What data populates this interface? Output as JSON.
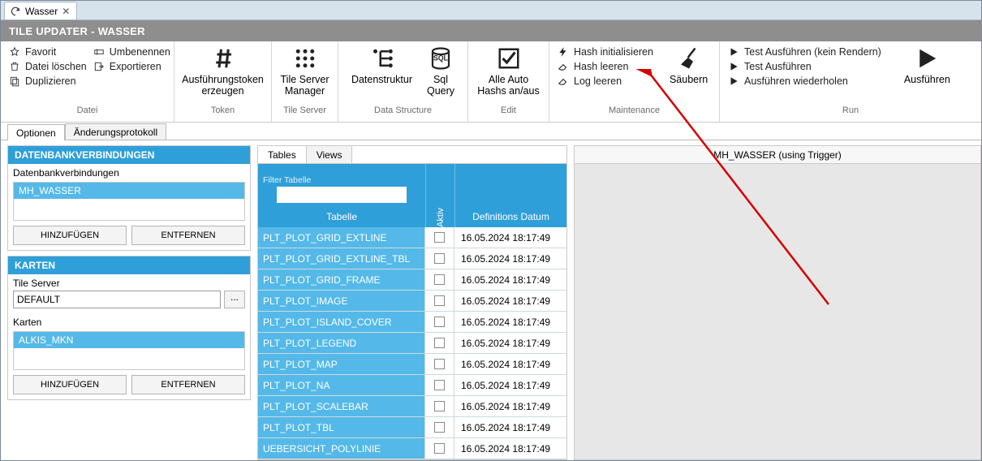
{
  "doc_tab": {
    "label": "Wasser"
  },
  "title": "TILE UPDATER - WASSER",
  "ribbon": {
    "datei": {
      "caption": "Datei",
      "favorit": "Favorit",
      "loeschen": "Datei löschen",
      "duplizieren": "Duplizieren",
      "umbenennen": "Umbenennen",
      "exportieren": "Exportieren"
    },
    "token": {
      "caption": "Token",
      "big": "Ausführungstoken\nerzeugen"
    },
    "tileserver": {
      "caption": "Tile Server",
      "big": "Tile Server\nManager"
    },
    "datastructure": {
      "caption": "Data Structure",
      "ds": "Datenstruktur",
      "sql": "Sql\nQuery"
    },
    "edit": {
      "caption": "Edit",
      "big": "Alle Auto\nHashs an/aus"
    },
    "maintenance": {
      "caption": "Maintenance",
      "hash_init": "Hash initialisieren",
      "hash_leeren": "Hash leeren",
      "log_leeren": "Log leeren",
      "saeubern": "Säubern"
    },
    "run": {
      "caption": "Run",
      "test_kein": "Test Ausführen (kein Rendern)",
      "test": "Test Ausführen",
      "wiederholen": "Ausführen wiederholen",
      "ausfuehren": "Ausführen"
    }
  },
  "subtabs": {
    "optionen": "Optionen",
    "protokoll": "Änderungsprotokoll"
  },
  "left": {
    "dbhead": "DATENBANKVERBINDUNGEN",
    "dblabel": "Datenbankverbindungen",
    "dbitem": "MH_WASSER",
    "add": "HINZUFÜGEN",
    "remove": "ENTFERNEN",
    "kartenhead": "KARTEN",
    "tslabel": "Tile Server",
    "tsvalue": "DEFAULT",
    "kartenlabel": "Karten",
    "kartenitem": "ALKIS_MKN"
  },
  "mid": {
    "tab_tables": "Tables",
    "tab_views": "Views",
    "filter_label": "Filter Tabelle",
    "col_tabelle": "Tabelle",
    "col_aktiv": "Aktiv",
    "col_def": "Definitions Datum",
    "rows": [
      {
        "t": "PLT_PLOT_GRID_EXTLINE",
        "d": "16.05.2024 18:17:49"
      },
      {
        "t": "PLT_PLOT_GRID_EXTLINE_TBL",
        "d": "16.05.2024 18:17:49"
      },
      {
        "t": "PLT_PLOT_GRID_FRAME",
        "d": "16.05.2024 18:17:49"
      },
      {
        "t": "PLT_PLOT_IMAGE",
        "d": "16.05.2024 18:17:49"
      },
      {
        "t": "PLT_PLOT_ISLAND_COVER",
        "d": "16.05.2024 18:17:49"
      },
      {
        "t": "PLT_PLOT_LEGEND",
        "d": "16.05.2024 18:17:49"
      },
      {
        "t": "PLT_PLOT_MAP",
        "d": "16.05.2024 18:17:49"
      },
      {
        "t": "PLT_PLOT_NA",
        "d": "16.05.2024 18:17:49"
      },
      {
        "t": "PLT_PLOT_SCALEBAR",
        "d": "16.05.2024 18:17:49"
      },
      {
        "t": "PLT_PLOT_TBL",
        "d": "16.05.2024 18:17:49"
      },
      {
        "t": "UEBERSICHT_POLYLINIE",
        "d": "16.05.2024 18:17:49"
      }
    ]
  },
  "right": {
    "title": "MH_WASSER (using Trigger)"
  }
}
